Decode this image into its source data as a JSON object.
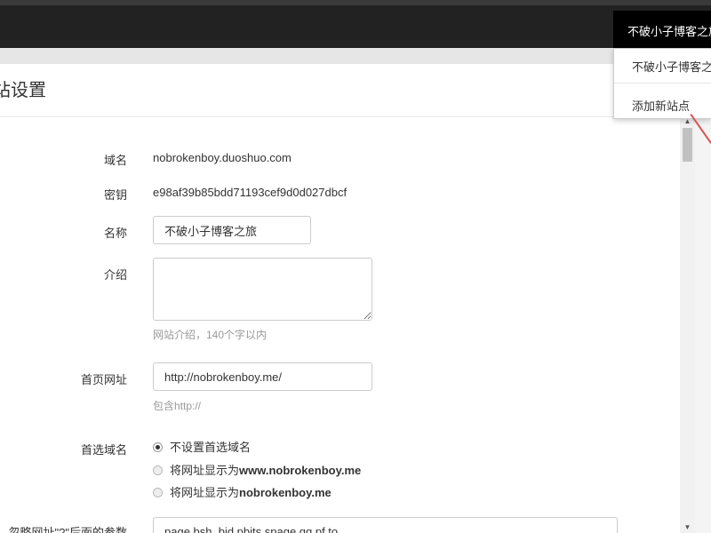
{
  "topbar": {
    "site_switcher_label": "不破小子博客之旅"
  },
  "dropdown": {
    "items": [
      {
        "label": "不破小子博客之旅"
      },
      {
        "label": "添加新站点"
      }
    ]
  },
  "page": {
    "title": "站设置"
  },
  "form": {
    "domain": {
      "label": "域名",
      "value": "nobrokenboy.duoshuo.com"
    },
    "secret": {
      "label": "密钥",
      "value": "e98af39b85bdd71193cef9d0d027dbcf"
    },
    "name": {
      "label": "名称",
      "value": "不破小子博客之旅"
    },
    "intro": {
      "label": "介绍",
      "value": "",
      "help": "网站介绍，140个字以内"
    },
    "homepage": {
      "label": "首页网址",
      "value": "http://nobrokenboy.me/",
      "help": "包含http://"
    },
    "preferred_domain": {
      "label": "首选域名",
      "options": [
        {
          "text": "不设置首选域名",
          "bold": "",
          "checked": true
        },
        {
          "text": "将网址显示为",
          "bold": "www.nobrokenboy.me",
          "checked": false
        },
        {
          "text": "将网址显示为",
          "bold": "nobrokenboy.me",
          "checked": false
        }
      ]
    },
    "ignore_params": {
      "label": "忽略网址\"?\"后面的参数",
      "value": "page,bsh_bid,pbits,spage,qq,pf,to"
    }
  },
  "colors": {
    "topbar": "#222222",
    "switcher": "#000000",
    "annotation_arrow": "#d9534f"
  }
}
